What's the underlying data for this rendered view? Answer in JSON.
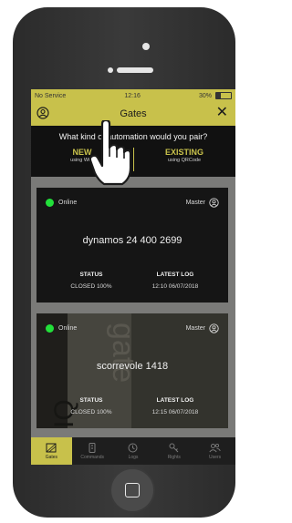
{
  "status_bar": {
    "carrier": "No Service",
    "time": "12:16",
    "battery": "30%"
  },
  "header": {
    "title": "Gates",
    "close_icon": "close-icon",
    "account_icon": "user-icon"
  },
  "pair": {
    "question": "What kind of automation would you pair?",
    "new_label": "NEW",
    "new_sub": "using WiFi",
    "existing_label": "EXISTING",
    "existing_sub": "using QRCode"
  },
  "devices": [
    {
      "status_label": "Online",
      "role": "Master",
      "name": "dynamos 24 400 2699",
      "status_heading": "STATUS",
      "status_value": "CLOSED 100%",
      "log_heading": "LATEST LOG",
      "log_value": "12:10 06/07/2018"
    },
    {
      "status_label": "Online",
      "role": "Master",
      "name": "scorrevole 1418",
      "status_heading": "STATUS",
      "status_value": "CLOSED 100%",
      "log_heading": "LATEST LOG",
      "log_value": "12:15 06/07/2018"
    }
  ],
  "tabs": [
    {
      "label": "Gates",
      "icon": "gate-icon",
      "active": true
    },
    {
      "label": "Commands",
      "icon": "remote-icon",
      "active": false
    },
    {
      "label": "Logs",
      "icon": "logs-icon",
      "active": false
    },
    {
      "label": "Rights",
      "icon": "key-icon",
      "active": false
    },
    {
      "label": "Users",
      "icon": "users-icon",
      "active": false
    }
  ],
  "colors": {
    "accent": "#c8c14b",
    "online": "#22e03a",
    "background": "#111111"
  }
}
